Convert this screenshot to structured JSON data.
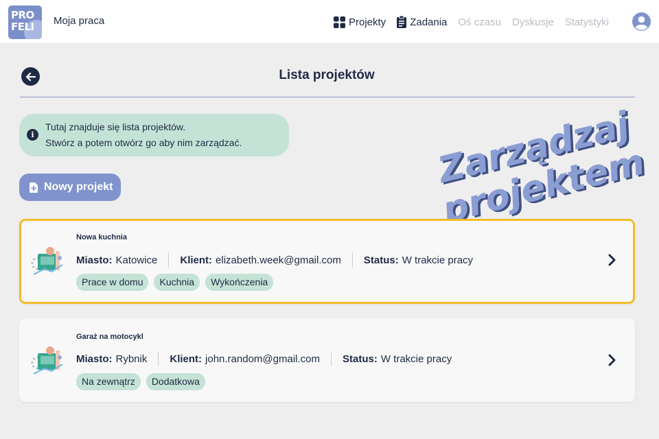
{
  "app": {
    "logo_text_1": "PRO",
    "logo_text_2": "FELI",
    "name": "Moja praca"
  },
  "nav": {
    "items": [
      {
        "label": "Projekty",
        "icon": "grid-icon",
        "enabled": true
      },
      {
        "label": "Zadania",
        "icon": "clipboard-icon",
        "enabled": true
      },
      {
        "label": "Oś czasu",
        "enabled": false
      },
      {
        "label": "Dyskusje",
        "enabled": false
      },
      {
        "label": "Statystyki",
        "enabled": false
      }
    ],
    "user_icon": "user-circle-icon"
  },
  "header": {
    "title": "Lista projektów",
    "back_icon": "arrow-left-icon"
  },
  "info": {
    "icon": "info-icon",
    "line1": "Tutaj znajduje się lista projektów.",
    "line2": "Stwórz a potem otwórz go aby nim zarządzać."
  },
  "new_project": {
    "label": "Nowy projekt",
    "icon": "file-plus-icon"
  },
  "stamp": {
    "line1": "Zarządzaj",
    "line2": "projektem"
  },
  "labels": {
    "city": "Miasto:",
    "client": "Klient:",
    "status": "Status:"
  },
  "projects": [
    {
      "name": "Nowa kuchnia",
      "city": "Katowice",
      "client": "elizabeth.week@gmail.com",
      "status": "W trakcie pracy",
      "tags": [
        "Prace w domu",
        "Kuchnia",
        "Wykończenia"
      ],
      "selected": true
    },
    {
      "name": "Garaż na motocykl",
      "city": "Rybnik",
      "client": "john.random@gmail.com",
      "status": "W trakcie pracy",
      "tags": [
        "Na zewnątrz",
        "Dodatkowa"
      ],
      "selected": false
    }
  ],
  "colors": {
    "primary": "#1f2a44",
    "accent": "#8193cc",
    "info_bg": "#c4e3d6",
    "selected_border": "#f2bd2a"
  }
}
